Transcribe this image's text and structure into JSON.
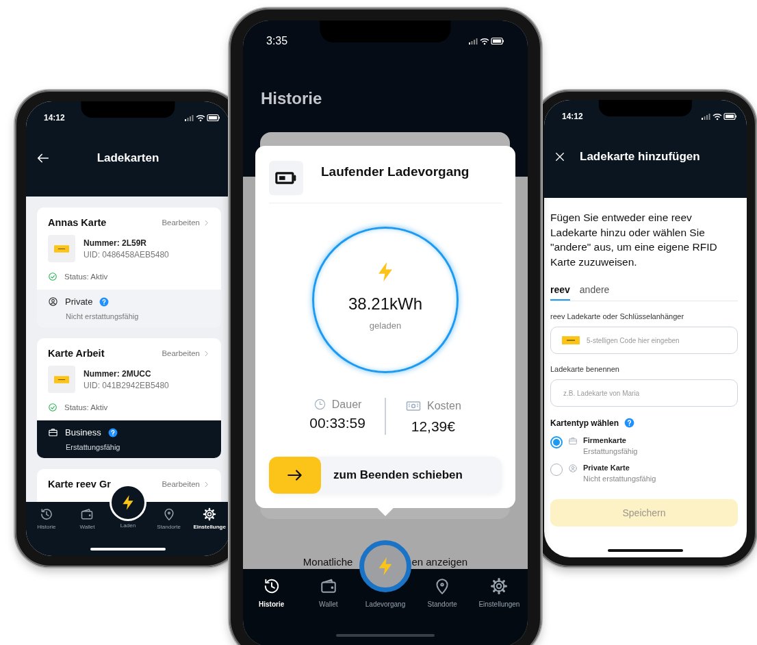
{
  "left_phone": {
    "status_time": "14:12",
    "title": "Ladekarten",
    "cards": [
      {
        "name": "Annas Karte",
        "edit": "Bearbeiten",
        "number": "Nummer: 2L59R",
        "uid": "UID: 0486458AEB5480",
        "status": "Status: Aktiv",
        "type": {
          "kind": "private",
          "label": "Private",
          "note": "Nicht erstattungsfähig",
          "selected": false
        }
      },
      {
        "name": "Karte Arbeit",
        "edit": "Bearbeiten",
        "number": "Nummer: 2MUCC",
        "uid": "UID: 041B2942EB5480",
        "status": "Status: Aktiv",
        "type": {
          "kind": "business",
          "label": "Business",
          "note": "Erstattungsfähig",
          "selected": true
        }
      },
      {
        "name": "Karte reev Gr",
        "edit": "Bearbeiten"
      }
    ],
    "tab_bar": [
      {
        "kind": "history",
        "label": "Historie",
        "selected": false
      },
      {
        "kind": "wallet",
        "label": "Wallet",
        "selected": false
      },
      {
        "kind": "charge",
        "label": "Laden",
        "selected": false
      },
      {
        "kind": "locations",
        "label": "Standorte",
        "selected": false
      },
      {
        "kind": "settings",
        "label": "Einstellunge",
        "selected": true
      }
    ]
  },
  "center_phone": {
    "status_time": "3:35",
    "title": "Historie",
    "modal": {
      "title": "Laufender Ladevorgang",
      "energy": "38.21kWh",
      "energy_caption": "geladen",
      "stats": [
        {
          "kind": "duration",
          "label": "Dauer",
          "value": "00:33:59"
        },
        {
          "kind": "cost",
          "label": "Kosten",
          "value": "12,39€"
        }
      ],
      "slider_label": "zum Beenden schieben"
    },
    "monthly_link": [
      "Monatliche",
      "en anzeigen"
    ],
    "tab_bar": [
      {
        "kind": "history",
        "label": "Historie",
        "selected": true
      },
      {
        "kind": "wallet",
        "label": "Wallet",
        "selected": false
      },
      {
        "kind": "charge",
        "label": "Ladevorgang",
        "selected": false
      },
      {
        "kind": "locations",
        "label": "Standorte",
        "selected": false
      },
      {
        "kind": "settings",
        "label": "Einstellungen",
        "selected": false
      }
    ]
  },
  "right_phone": {
    "status_time": "14:12",
    "title": "Ladekarte hinzufügen",
    "intro": "Fügen Sie entweder eine reev Ladekarte hinzu oder wählen Sie \"andere\" aus, um eine eigene RFID Karte zuzuweisen.",
    "tabs": [
      {
        "label": "reev",
        "selected": true
      },
      {
        "label": "andere",
        "selected": false
      }
    ],
    "code_field": {
      "label": "reev Ladekarte oder Schlüsselanhänger",
      "placeholder": "5-stelligen Code hier eingeben"
    },
    "name_field": {
      "label": "Ladekarte benennen",
      "placeholder": "z.B. Ladekarte von Maria"
    },
    "card_type": {
      "label": "Kartentyp wählen",
      "options": [
        {
          "kind": "business",
          "label": "Firmenkarte",
          "note": "Erstattungsfähig",
          "selected": true
        },
        {
          "kind": "private",
          "label": "Private Karte",
          "note": "Nicht erstattungsfähig",
          "selected": false
        }
      ]
    },
    "save_button": {
      "label": "Speichern",
      "disabled": true
    }
  }
}
